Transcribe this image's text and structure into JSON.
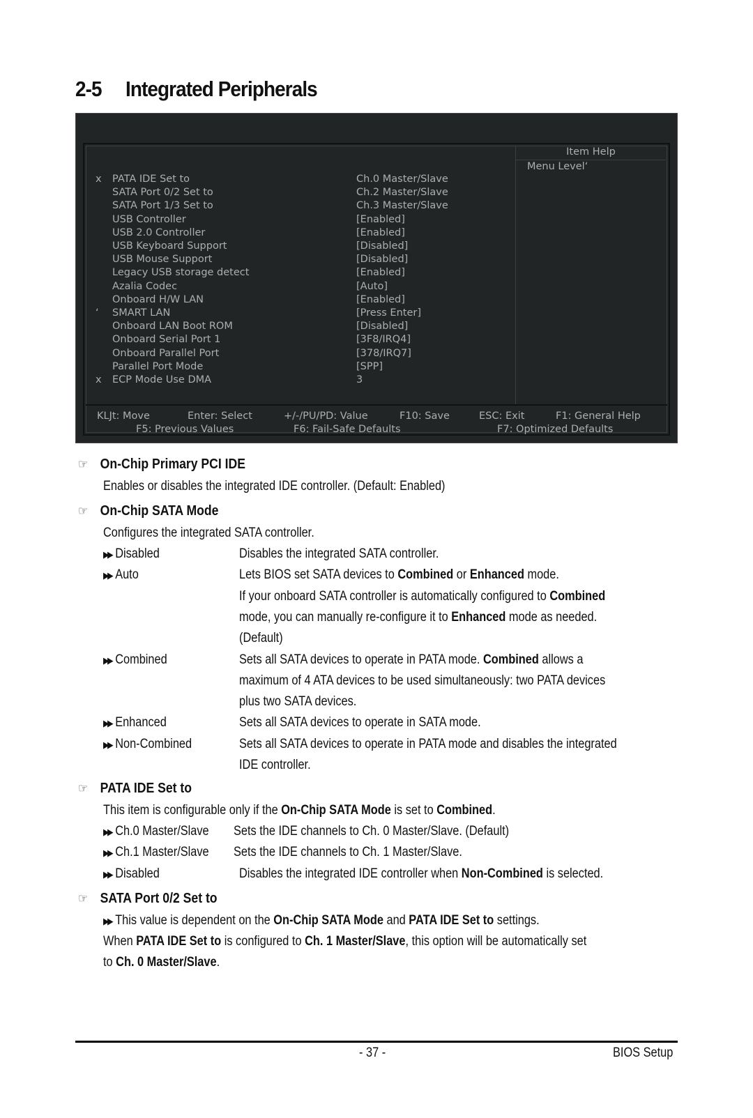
{
  "page": {
    "section_number": "2-5",
    "section_title": "Integrated Peripherals",
    "page_number": "- 37 -",
    "footer_right": "BIOS Setup"
  },
  "bios": {
    "help_title": "Item Help",
    "help_menu_level": "Menu Level‘",
    "items": [
      {
        "mark": "x",
        "label": "PATA IDE Set to",
        "value": "Ch.0 Master/Slave"
      },
      {
        "mark": "",
        "label": "SATA Port 0/2 Set to",
        "value": "Ch.2 Master/Slave"
      },
      {
        "mark": "",
        "label": "SATA Port 1/3 Set to",
        "value": "Ch.3 Master/Slave"
      },
      {
        "mark": "",
        "label": "USB Controller",
        "value": "[Enabled]"
      },
      {
        "mark": "",
        "label": "USB 2.0 Controller",
        "value": "[Enabled]"
      },
      {
        "mark": "",
        "label": "USB Keyboard Support",
        "value": "[Disabled]"
      },
      {
        "mark": "",
        "label": "USB Mouse Support",
        "value": "[Disabled]"
      },
      {
        "mark": "",
        "label": "Legacy USB storage detect",
        "value": "[Enabled]"
      },
      {
        "mark": "",
        "label": "Azalia Codec",
        "value": "[Auto]"
      },
      {
        "mark": "",
        "label": "Onboard H/W LAN",
        "value": "[Enabled]"
      },
      {
        "mark": "‘",
        "label": "SMART LAN",
        "value": "[Press Enter]"
      },
      {
        "mark": "",
        "label": "Onboard LAN Boot ROM",
        "value": "[Disabled]"
      },
      {
        "mark": "",
        "label": "Onboard Serial Port 1",
        "value": "[3F8/IRQ4]"
      },
      {
        "mark": "",
        "label": "Onboard Parallel Port",
        "value": "[378/IRQ7]"
      },
      {
        "mark": "",
        "label": "Parallel Port Mode",
        "value": "[SPP]"
      },
      {
        "mark": "x",
        "label": "ECP Mode Use DMA",
        "value": "3"
      }
    ],
    "keys_row1": [
      "KLJt: Move",
      "Enter: Select",
      "+/-/PU/PD: Value",
      "F10: Save",
      "ESC: Exit",
      "F1: General Help"
    ],
    "keys_row2": [
      "F5: Previous Values",
      "F6: Fail-Safe Defaults",
      "F7: Optimized Defaults"
    ]
  },
  "sections": {
    "primary_pci_ide": {
      "heading": "On-Chip Primary PCI IDE",
      "text": "Enables or disables the integrated IDE controller. (Default: Enabled)"
    },
    "sata_mode": {
      "heading": "On-Chip SATA Mode",
      "text": "Configures the integrated SATA controller.",
      "options": [
        {
          "name": "Disabled",
          "lines": [
            "Disables the integrated SATA controller."
          ]
        },
        {
          "name": "Auto",
          "lines": [
            "Lets BIOS set SATA devices to <b>Combined</b> or <b>Enhanced</b> mode.",
            "If your onboard SATA controller is automatically configured to <b>Combined</b>",
            "mode, you can manually re-configure it to <b>Enhanced</b> mode as needed.",
            "(Default)"
          ]
        },
        {
          "name": "Combined",
          "lines": [
            "Sets all SATA devices to operate in PATA mode. <b>Combined</b> allows a",
            "maximum of 4 ATA devices to be used simultaneously: two PATA devices",
            "plus two SATA devices."
          ]
        },
        {
          "name": "Enhanced",
          "lines": [
            "Sets all SATA devices to operate in SATA mode."
          ]
        },
        {
          "name": "Non-Combined",
          "lines": [
            "Sets all SATA devices to operate in PATA mode and disables the integrated",
            "IDE controller."
          ]
        }
      ]
    },
    "pata_ide": {
      "heading": "PATA IDE Set to",
      "text": "This item is configurable only if the <b>On-Chip SATA Mode</b> is set to <b>Combined</b>.",
      "options": [
        {
          "name": "Ch.0 Master/Slave",
          "desc": "Sets the IDE channels to Ch. 0 Master/Slave. (Default)"
        },
        {
          "name": "Ch.1 Master/Slave",
          "desc": "Sets the IDE channels to Ch. 1 Master/Slave."
        },
        {
          "name": "Disabled",
          "desc": "Disables the integrated IDE controller when <b>Non-Combined</b> is selected."
        }
      ]
    },
    "sata_port02": {
      "heading": "SATA Port 0/2 Set to",
      "bullet": "This value is dependent on the <b>On-Chip SATA Mode</b> and <b>PATA IDE Set to</b> settings.",
      "text_lines": [
        "When <b>PATA IDE Set to</b> is configured to <b>Ch. 1 Master/Slave</b>, this option will be automatically set",
        "to <b>Ch. 0 Master/Slave</b>."
      ]
    }
  }
}
